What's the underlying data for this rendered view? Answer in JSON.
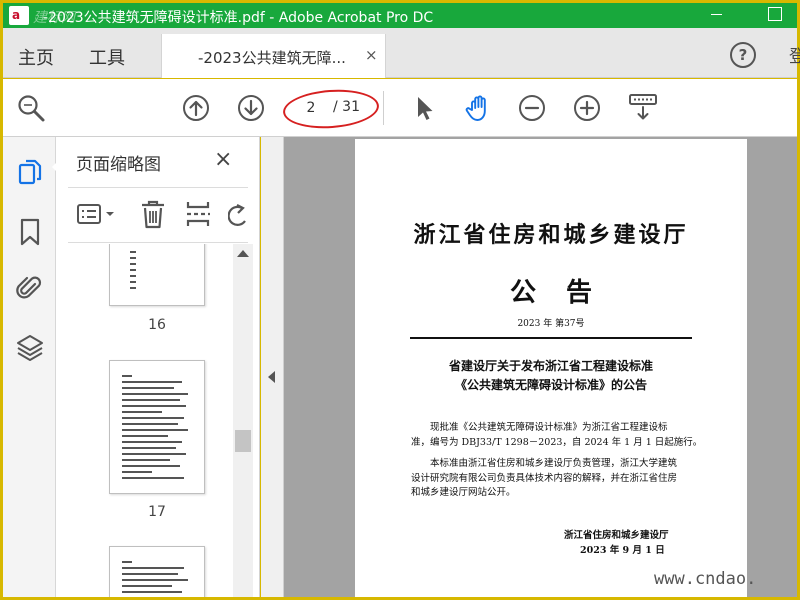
{
  "window": {
    "title": "-2023公共建筑无障碍设计标准.pdf - Adobe Acrobat Pro DC",
    "logo_text": "a",
    "watermark_text": "建标网"
  },
  "tabs": {
    "home": "主页",
    "tools": "工具",
    "document_tab": "-2023公共建筑无障...",
    "document_tab_close": "×",
    "help": "?",
    "cut_label": "登"
  },
  "toolbar": {
    "current_page": "2",
    "total_pages": "/ 31"
  },
  "thumbnail_panel": {
    "title": "页面缩略图",
    "close": "×",
    "pages": [
      "16",
      "17"
    ]
  },
  "document": {
    "org_title": "浙江省住房和城乡建设厅",
    "notice_title": "公告",
    "issue_no": "2023 年 第37号",
    "subject_line1": "省建设厅关于发布浙江省工程建设标准",
    "subject_line2": "《公共建筑无障碍设计标准》的公告",
    "para1": [
      "现批准《公共建筑无障碍设计标准》为浙江省工程建设标",
      "准，编号为 DBJ33/T 1298－2023，自 2024 年 1 月 1 日起施行。"
    ],
    "para2": [
      "本标准由浙江省住房和城乡建设厅负责管理，浙江大学建筑",
      "设计研究院有限公司负责具体技术内容的解释，并在浙江省住房",
      "和城乡建设厅网站公开。"
    ],
    "sign_org": "浙江省住房和城乡建设厅",
    "sign_date": "2023 年 9 月 1 日"
  },
  "overlay": {
    "site_watermark": "www.cndao."
  },
  "colors": {
    "title_bar": "#18a83c",
    "frame": "#d7b800",
    "accent_blue": "#1473e6",
    "highlight_red": "#d62020",
    "icon_gray": "#555555"
  }
}
